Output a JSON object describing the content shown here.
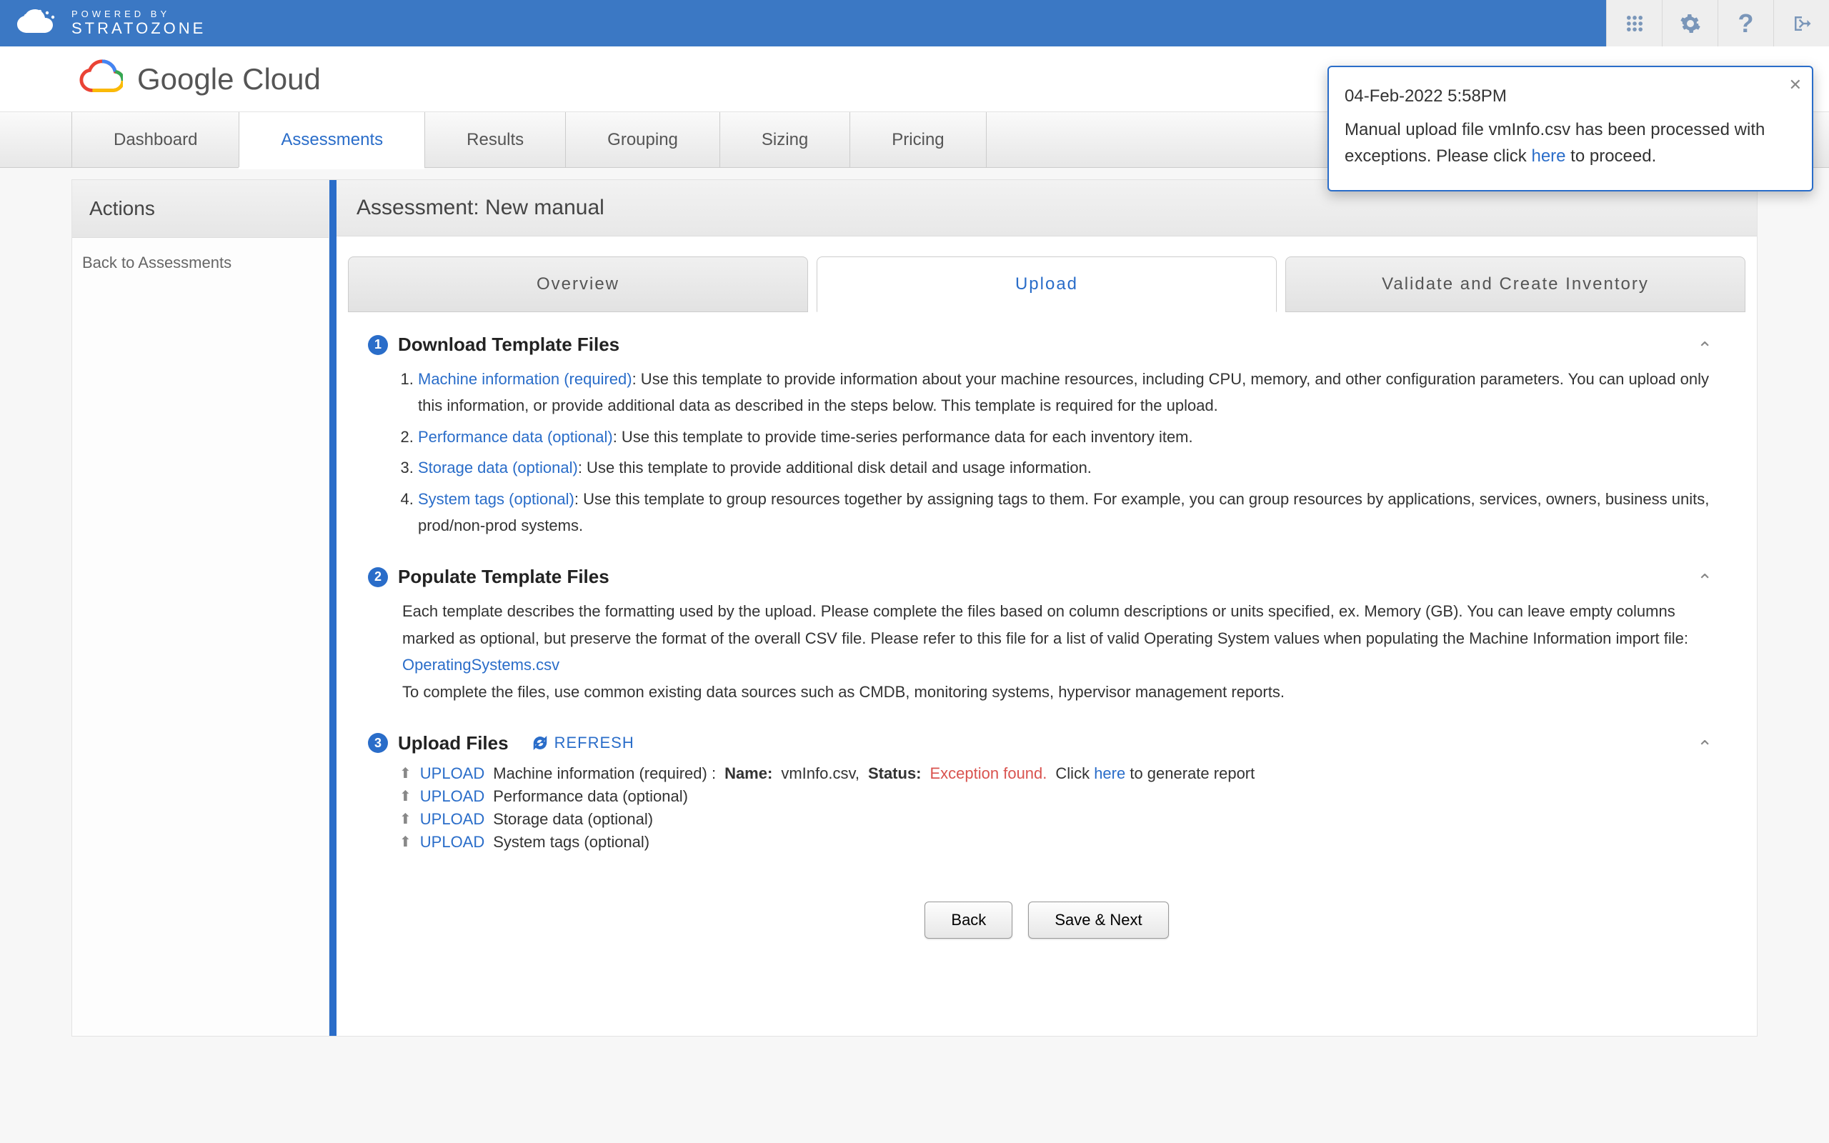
{
  "brand": {
    "powered_by": "POWERED BY",
    "name": "STRATOZONE"
  },
  "gc_logo": {
    "bold": "Google",
    "rest": " Cloud"
  },
  "nav": {
    "items": [
      {
        "label": "Dashboard",
        "active": false
      },
      {
        "label": "Assessments",
        "active": true
      },
      {
        "label": "Results",
        "active": false
      },
      {
        "label": "Grouping",
        "active": false
      },
      {
        "label": "Sizing",
        "active": false
      },
      {
        "label": "Pricing",
        "active": false
      }
    ]
  },
  "sidebar": {
    "title": "Actions",
    "back": "Back to Assessments"
  },
  "main": {
    "title": "Assessment: New manual",
    "subtabs": [
      {
        "label": "Overview",
        "active": false
      },
      {
        "label": "Upload",
        "active": true
      },
      {
        "label": "Validate and Create Inventory",
        "active": false
      }
    ]
  },
  "section1": {
    "badge": "1",
    "title": "Download Template Files",
    "items": [
      {
        "link": "Machine information (required)",
        "rest": ": Use this template to provide information about your machine resources, including CPU, memory, and other configuration parameters. You can upload only this information, or provide additional data as described in the steps below. This template is required for the upload."
      },
      {
        "link": "Performance data (optional)",
        "rest": ": Use this template to provide time-series performance data for each inventory item."
      },
      {
        "link": "Storage data (optional)",
        "rest": ": Use this template to provide additional disk detail and usage information."
      },
      {
        "link": "System tags (optional)",
        "rest": ": Use this template to group resources together by assigning tags to them. For example, you can group resources by applications, services, owners, business units, prod/non-prod systems."
      }
    ]
  },
  "section2": {
    "badge": "2",
    "title": "Populate Template Files",
    "p1_a": "Each template describes the formatting used by the upload. Please complete the files based on column descriptions or units specified, ex. Memory (GB). You can leave empty columns marked as optional, but preserve the format of the overall CSV file. Please refer to this file for a list of valid Operating System values when populating the Machine Information import file: ",
    "p1_link": "OperatingSystems.csv",
    "p2": "To complete the files, use common existing data sources such as CMDB, monitoring systems, hypervisor management reports."
  },
  "section3": {
    "badge": "3",
    "title": "Upload Files",
    "refresh": "REFRESH",
    "rows": [
      {
        "upload": "UPLOAD",
        "desc": "Machine information (required) :",
        "name_label": "Name:",
        "name_value": "vmInfo.csv,",
        "status_label": "Status:",
        "status_value": "Exception found.",
        "click": "Click ",
        "here": "here",
        "after": " to generate report"
      },
      {
        "upload": "UPLOAD",
        "desc": "Performance data (optional)"
      },
      {
        "upload": "UPLOAD",
        "desc": "Storage data (optional)"
      },
      {
        "upload": "UPLOAD",
        "desc": "System tags (optional)"
      }
    ]
  },
  "buttons": {
    "back": "Back",
    "save_next": "Save & Next"
  },
  "toast": {
    "timestamp": "04-Feb-2022 5:58PM",
    "msg_a": "Manual upload file vmInfo.csv has been processed with exceptions. Please click ",
    "here": "here",
    "msg_b": " to proceed."
  }
}
